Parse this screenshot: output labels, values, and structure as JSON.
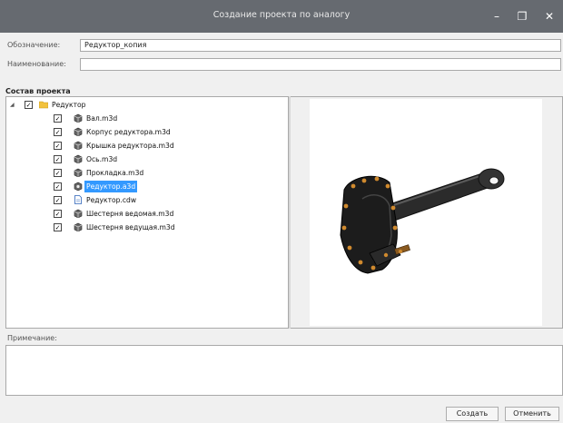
{
  "window": {
    "title": "Создание проекта по аналогу",
    "minimize": "–",
    "maximize": "❐",
    "close": "✕"
  },
  "form": {
    "designation_label": "Обозначение:",
    "designation_value": "Редуктор_копия",
    "name_label": "Наименование:",
    "name_value": ""
  },
  "project": {
    "section_label": "Состав проекта",
    "root": {
      "label": "Редуктор",
      "expand": "◢"
    },
    "items": [
      {
        "label": "Вал.m3d",
        "icon": "part-icon"
      },
      {
        "label": "Корпус редуктора.m3d",
        "icon": "part-icon"
      },
      {
        "label": "Крышка редуктора.m3d",
        "icon": "part-icon"
      },
      {
        "label": "Ось.m3d",
        "icon": "part-icon"
      },
      {
        "label": "Прокладка.m3d",
        "icon": "part-icon"
      },
      {
        "label": "Редуктор.a3d",
        "icon": "assembly-icon",
        "selected": true
      },
      {
        "label": "Редуктор.cdw",
        "icon": "drawing-icon"
      },
      {
        "label": "Шестерня ведомая.m3d",
        "icon": "part-icon"
      },
      {
        "label": "Шестерня ведущая.m3d",
        "icon": "part-icon"
      }
    ],
    "check_mark": "✓"
  },
  "note": {
    "label": "Примечание:",
    "value": ""
  },
  "buttons": {
    "create": "Создать",
    "cancel": "Отменить"
  },
  "colors": {
    "titlebar": "#666a70",
    "selection": "#3399ff",
    "folder": "#f2c23d"
  }
}
